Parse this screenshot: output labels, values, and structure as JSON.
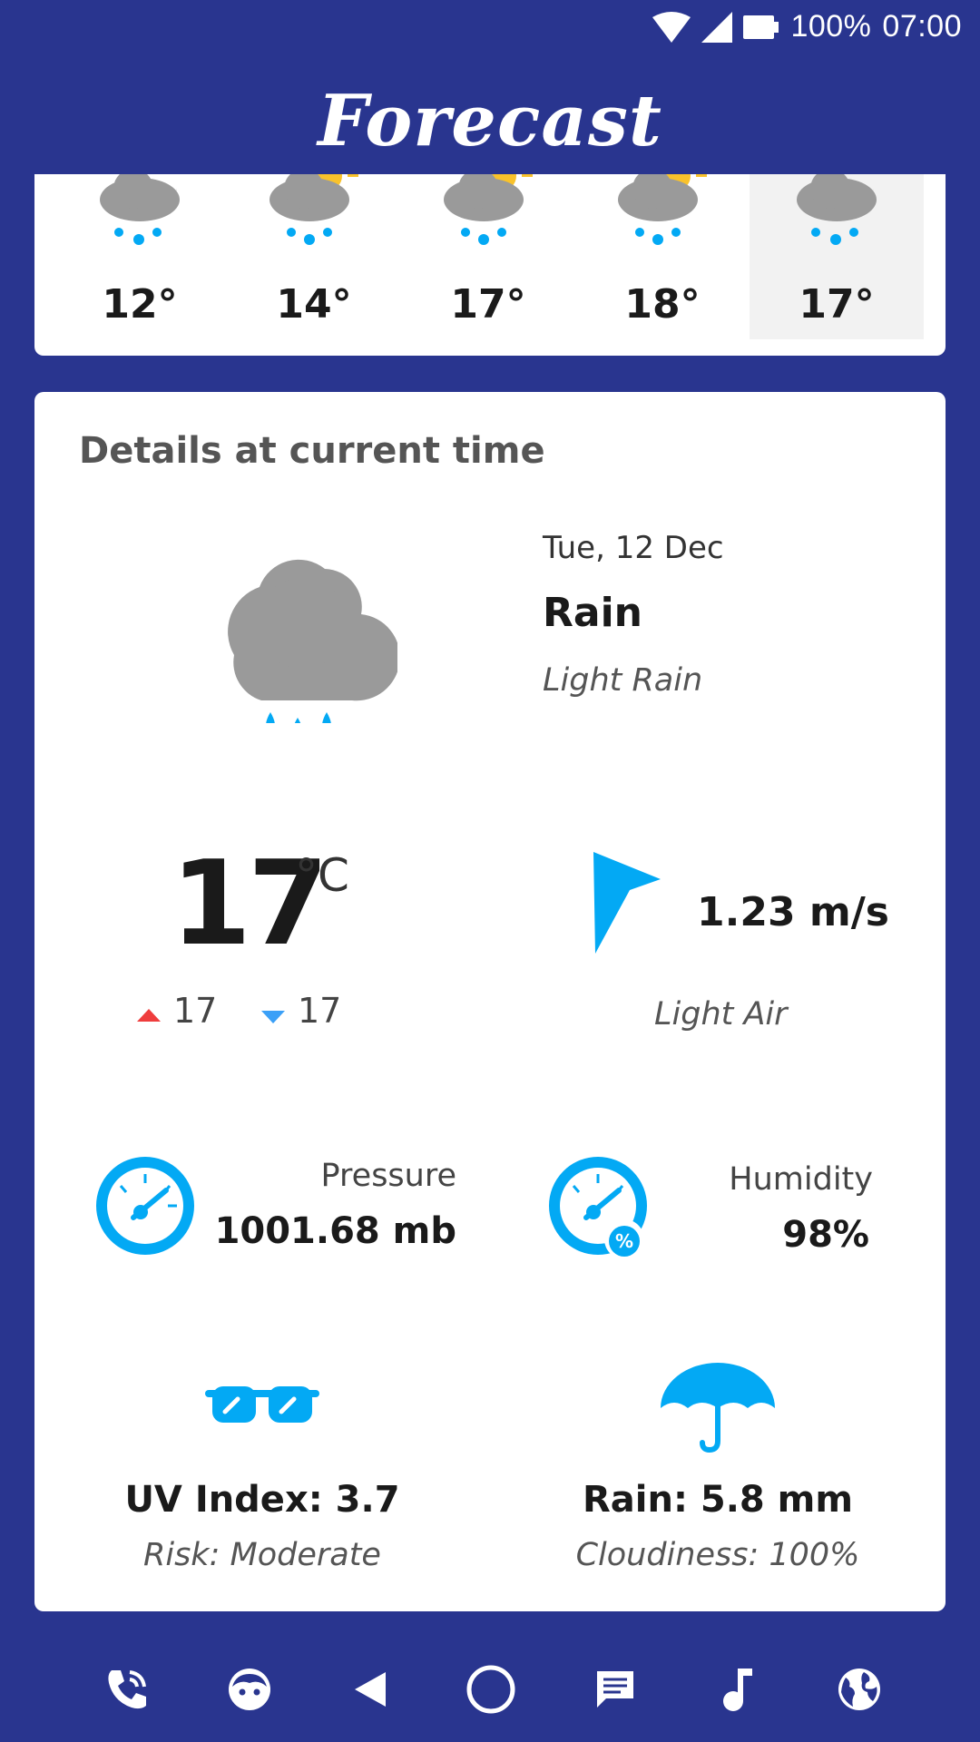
{
  "status_bar": {
    "battery": "100%",
    "time": "07:00"
  },
  "app": {
    "title": "Forecast"
  },
  "hourly": [
    {
      "temp": "12°",
      "icon": "rain-night-icon"
    },
    {
      "temp": "14°",
      "icon": "rain-day-icon"
    },
    {
      "temp": "17°",
      "icon": "rain-day-icon"
    },
    {
      "temp": "18°",
      "icon": "rain-day-icon"
    },
    {
      "temp": "17°",
      "icon": "rain-night-icon",
      "selected": true
    }
  ],
  "details": {
    "title": "Details at current time",
    "date": "Tue, 12 Dec",
    "condition": "Rain",
    "description": "Light Rain",
    "temperature": "17",
    "unit": "°C",
    "high": "17",
    "low": "17",
    "wind_speed": "1.23 m/s",
    "wind_description": "Light Air",
    "pressure_label": "Pressure",
    "pressure_value": "1001.68 mb",
    "humidity_label": "Humidity",
    "humidity_value": "98%",
    "uv": "UV Index: 3.7",
    "uv_risk": "Risk: Moderate",
    "rain": "Rain: 5.8 mm",
    "cloudiness": "Cloudiness: 100%"
  },
  "colors": {
    "accent": "#03a9f4",
    "background": "#29358f",
    "high": "#ef3d3d",
    "low": "#3ba0f7"
  },
  "navbar": [
    "phone-icon",
    "face-icon",
    "back-icon",
    "home-icon",
    "messages-icon",
    "music-icon",
    "globe-icon"
  ]
}
